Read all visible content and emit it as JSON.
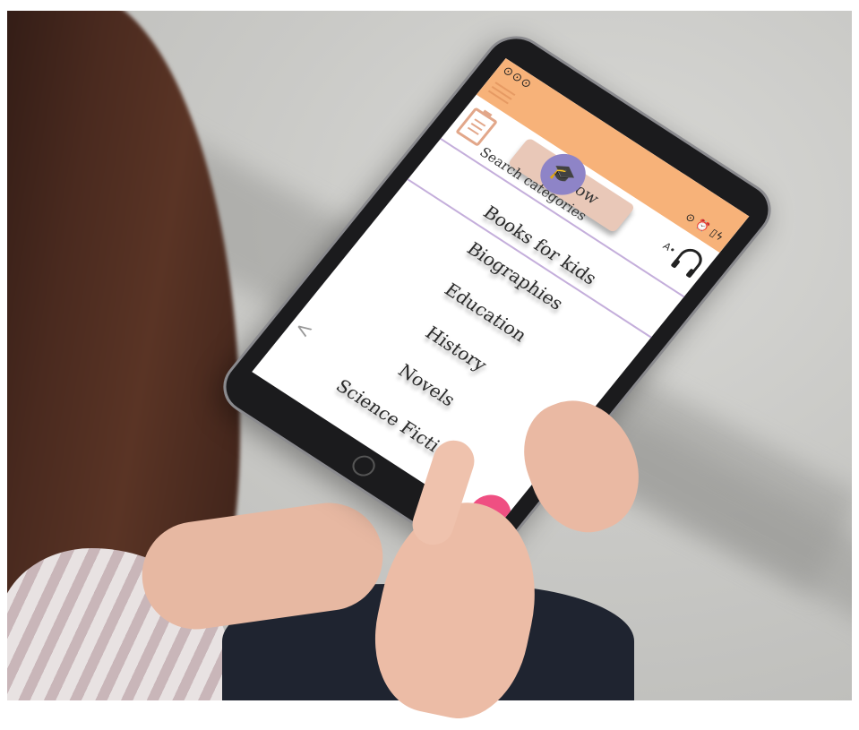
{
  "status_bar": {
    "left_icons": "⊙⊙⊙",
    "right_icons": "⊙ ⏰ ▯ϟ"
  },
  "toolbar": {
    "borrow_label": "borrow",
    "text_size_label": "A•"
  },
  "search": {
    "label": "Search categories"
  },
  "categories": [
    "Books for kids",
    "Biographies",
    "Education",
    "History",
    "Novels",
    "Science Fiction"
  ],
  "nav": {
    "back_glyph": "<"
  },
  "colors": {
    "status_bar": "#f7b279",
    "borrow_button": "#e9c8b8",
    "cap_badge": "#8e84c7",
    "divider": "#c4aedb",
    "fab": "#ef4f82"
  },
  "icons": [
    "menu-icon",
    "clipboard-icon",
    "graduation-cap-icon",
    "headphones-icon",
    "back-arrow-icon"
  ]
}
